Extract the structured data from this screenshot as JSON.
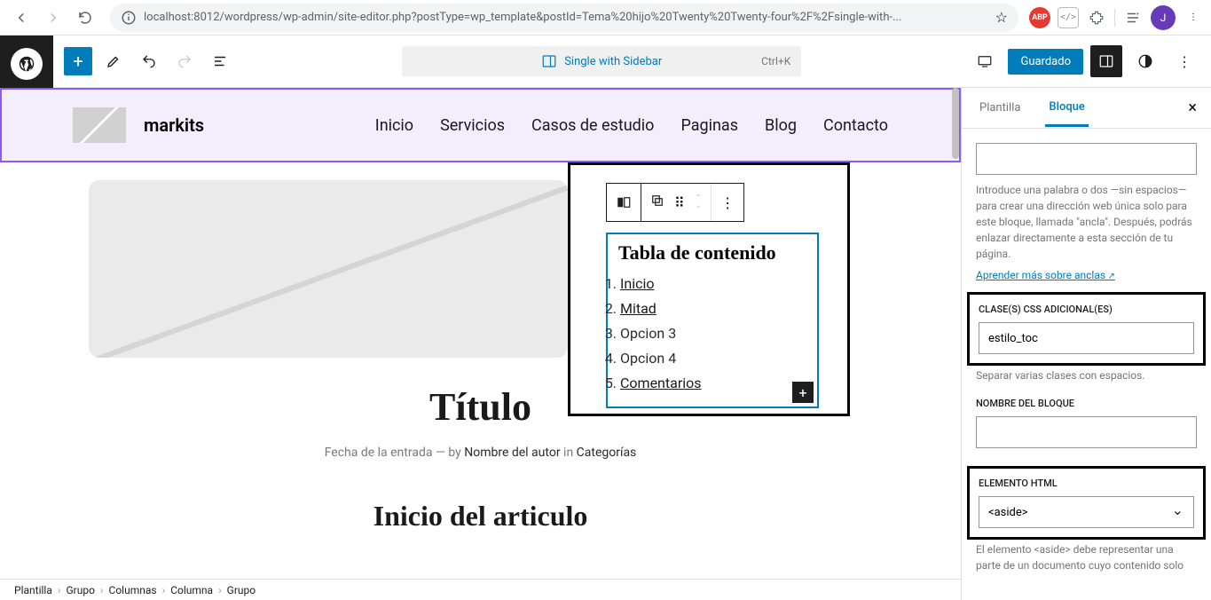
{
  "browser": {
    "url": "localhost:8012/wordpress/wp-admin/site-editor.php?postType=wp_template&postId=Tema%20hijo%20Twenty%20Twenty-four%2F%2Fsingle-with-...",
    "avatar_initial": "J",
    "abp_label": "ABP"
  },
  "topbar": {
    "doc_title": "Single with Sidebar",
    "shortcut": "Ctrl+K",
    "save_label": "Guardado"
  },
  "site": {
    "name": "markits",
    "nav": [
      "Inicio",
      "Servicios",
      "Casos de estudio",
      "Paginas",
      "Blog",
      "Contacto"
    ]
  },
  "post": {
    "title": "Título",
    "meta_date": "Fecha de la entrada",
    "meta_sep": " — by ",
    "meta_author": "Nombre del autor",
    "meta_in": " in ",
    "meta_cat": "Categorías",
    "section_heading": "Inicio del articulo"
  },
  "toc": {
    "title": "Tabla de contenido",
    "items": [
      {
        "label": "Inicio",
        "link": true
      },
      {
        "label": "Mitad",
        "link": true
      },
      {
        "label": "Opcion 3",
        "link": false
      },
      {
        "label": "Opcion 4",
        "link": false
      },
      {
        "label": "Comentarios",
        "link": true
      }
    ]
  },
  "sidebar": {
    "tab_template": "Plantilla",
    "tab_block": "Bloque",
    "anchor_help": "Introduce una palabra o dos —sin espacios— para crear una dirección web única solo para este bloque, llamada \"ancla\". Después, podrás enlazar directamente a esta sección de tu página.",
    "anchor_link": "Aprender más sobre anclas",
    "css_label": "CLASE(S) CSS ADICIONAL(ES)",
    "css_value": "estilo_toc",
    "css_help": "Separar varias clases con espacios.",
    "blockname_label": "NOMBRE DEL BLOQUE",
    "html_label": "ELEMENTO HTML",
    "html_value": "<aside>",
    "html_help": "El elemento <aside> debe representar una parte de un documento cuyo contenido solo"
  },
  "breadcrumb": [
    "Plantilla",
    "Grupo",
    "Columnas",
    "Columna",
    "Grupo"
  ]
}
